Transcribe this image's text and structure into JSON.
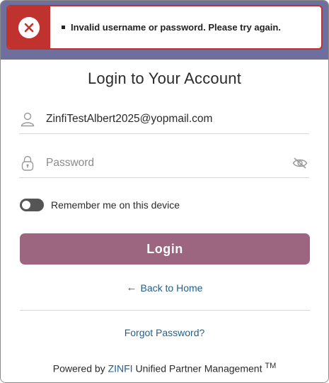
{
  "toast": {
    "message": "Invalid username or password. Please try again.",
    "icon": "close-icon",
    "color": "#c0322d"
  },
  "header": {
    "band_color": "#6e6f9c"
  },
  "form": {
    "title": "Login to Your Account",
    "username": {
      "value": "ZinfiTestAlbert2025@yopmail.com",
      "icon": "user-icon"
    },
    "password": {
      "placeholder": "Password",
      "icon": "lock-icon",
      "toggle_icon": "eye-off-icon"
    },
    "remember": {
      "label": "Remember me on this device",
      "checked": false
    },
    "login_label": "Login",
    "login_color": "#9d6680"
  },
  "links": {
    "back_arrow": "←",
    "back_home": "Back to Home",
    "forgot": "Forgot Password?"
  },
  "footer": {
    "prefix": "Powered by ",
    "brand": "ZINFI",
    "suffix": " Unified Partner Management ",
    "tm": "TM"
  }
}
